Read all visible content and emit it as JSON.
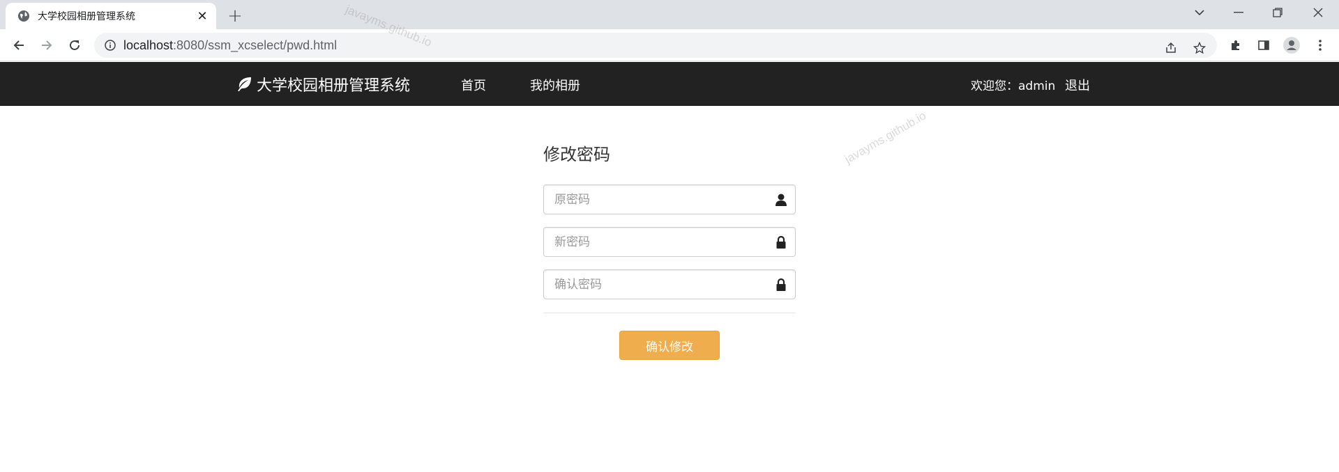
{
  "browser": {
    "tab_title": "大学校园相册管理系统",
    "tab_close": "✕",
    "new_tab": "+",
    "url_host": "localhost",
    "url_path": ":8080/ssm_xcselect/pwd.html"
  },
  "site": {
    "brand": "大学校园相册管理系统",
    "nav": [
      {
        "label": "首页"
      },
      {
        "label": "我的相册"
      }
    ],
    "welcome": "欢迎您：admin",
    "logout": "退出"
  },
  "form": {
    "title": "修改密码",
    "old_password_placeholder": "原密码",
    "new_password_placeholder": "新密码",
    "confirm_password_placeholder": "确认密码",
    "submit_label": "确认修改"
  },
  "watermark": "javayms.github.io",
  "colors": {
    "navbar_bg": "#222222",
    "button_bg": "#f0ad4e",
    "tabstrip_bg": "#dee1e6"
  },
  "icons": {
    "old_password": "user-icon",
    "new_password": "lock-icon",
    "confirm_password": "lock-icon"
  }
}
